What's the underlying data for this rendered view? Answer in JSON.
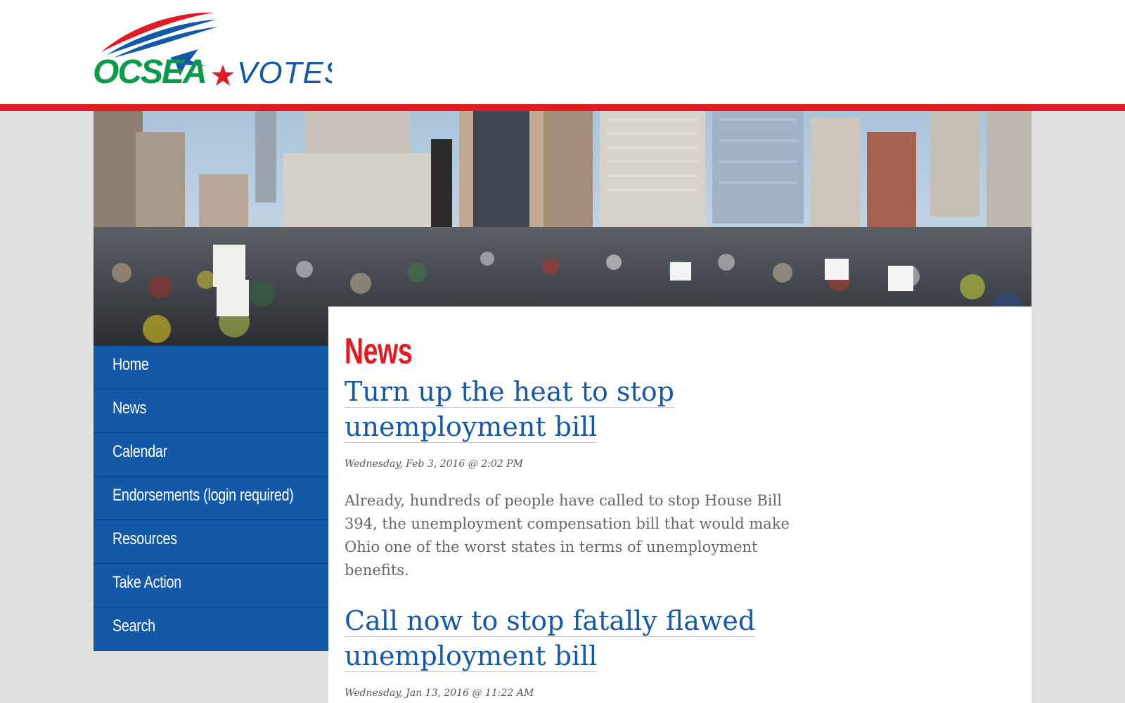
{
  "logo": {
    "brand": "OCSEA",
    "tagline": "VOTES",
    "colors": {
      "green": "#0a9a4a",
      "red": "#e21b23",
      "blue": "#1458a8"
    }
  },
  "banner": {
    "image": "rally-crowd-photo"
  },
  "nav": {
    "items": [
      {
        "label": "Home"
      },
      {
        "label": "News"
      },
      {
        "label": "Calendar"
      },
      {
        "label": "Endorsements (login required)"
      },
      {
        "label": "Resources"
      },
      {
        "label": "Take Action"
      },
      {
        "label": "Search"
      }
    ]
  },
  "main": {
    "page_title": "News",
    "articles": [
      {
        "title": "Turn up the heat to stop unemployment bill",
        "date": "Wednesday, Feb 3, 2016 @ 2:02 PM",
        "summary": "Already, hundreds of people have called to stop House Bill 394, the unemployment compensation bill that would make Ohio one of the worst states in terms of unemployment benefits."
      },
      {
        "title": "Call now to stop fatally flawed unemployment bill",
        "date": "Wednesday, Jan 13, 2016 @ 11:22 AM"
      }
    ]
  },
  "theme": {
    "accent_red": "#e21b23",
    "nav_blue": "#1458a8",
    "link_blue": "#1458a8"
  }
}
